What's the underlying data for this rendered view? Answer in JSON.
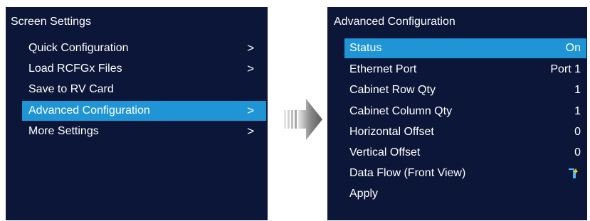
{
  "left_panel": {
    "title": "Screen Settings",
    "items": [
      {
        "label": "Quick Configuration",
        "chevron": ">"
      },
      {
        "label": "Load RCFGx Files",
        "chevron": ">"
      },
      {
        "label": "Save to RV Card",
        "chevron": ""
      },
      {
        "label": "Advanced Configuration",
        "chevron": ">"
      },
      {
        "label": "More Settings",
        "chevron": ">"
      }
    ],
    "selected_item": "Advanced Configuration"
  },
  "right_panel": {
    "title": "Advanced Configuration",
    "rows": [
      {
        "label": "Status",
        "value": "On"
      },
      {
        "label": "Ethernet Port",
        "value": "Port 1"
      },
      {
        "label": "Cabinet Row Qty",
        "value": "1"
      },
      {
        "label": "Cabinet Column Qty",
        "value": "1"
      },
      {
        "label": "Horizontal Offset",
        "value": "0"
      },
      {
        "label": "Vertical Offset",
        "value": "0"
      },
      {
        "label": "Data Flow (Front View)",
        "icon": "data-flow-icon"
      },
      {
        "label": "Apply",
        "value": ""
      }
    ],
    "selected_row": "Status"
  },
  "transition_arrow": {
    "icon": "right-arrow-icon"
  },
  "colors": {
    "panel_bg": "#0c1638",
    "highlight": "#1f95d5",
    "text": "#ffffff",
    "flow_icon_accent": "#f5c400"
  }
}
